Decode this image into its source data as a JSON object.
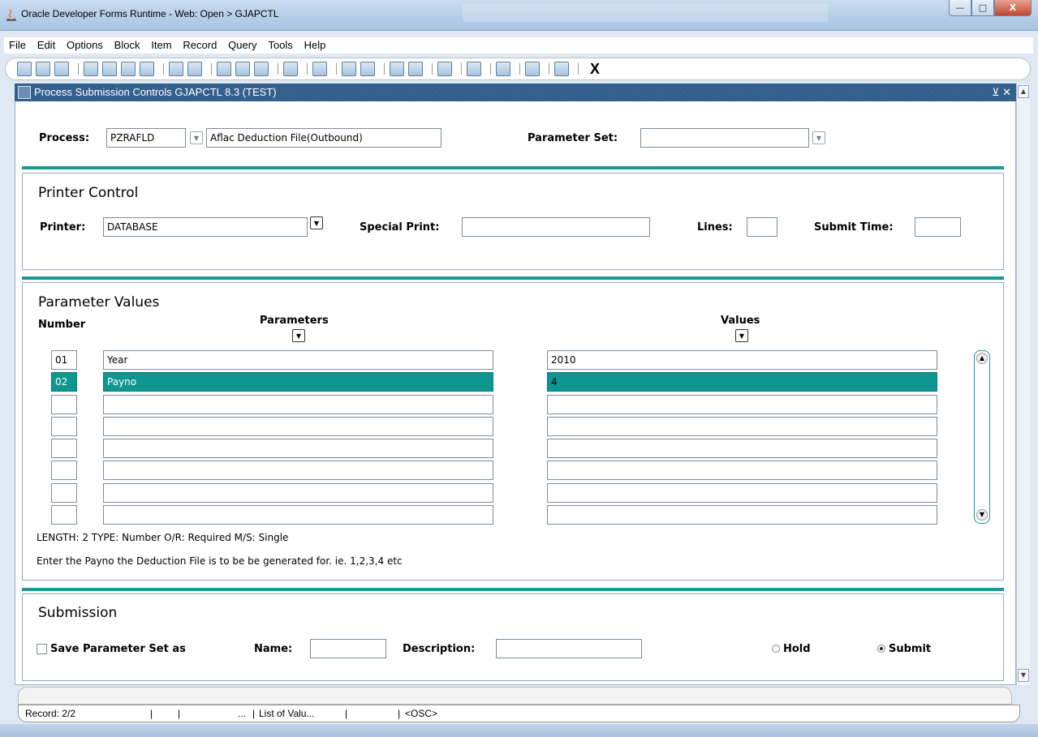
{
  "window": {
    "title": "Oracle Developer Forms Runtime - Web:  Open > GJAPCTL",
    "min_label": "—",
    "max_label": "□",
    "close_label": "X"
  },
  "menu": [
    "File",
    "Edit",
    "Options",
    "Block",
    "Item",
    "Record",
    "Query",
    "Tools",
    "Help"
  ],
  "menu_underline": [
    "F",
    "E",
    "O",
    "B",
    "I",
    "R",
    "Q",
    "T",
    "H"
  ],
  "toolbar": {
    "icons": [
      "save-icon",
      "rollback-icon",
      "print-icon",
      "insert-record-icon",
      "remove-record-icon",
      "first-record-icon",
      "last-record-icon",
      "enter-query-icon",
      "execute-query-icon",
      "count-query-icon",
      "cancel-query-icon",
      "duplicate-icon",
      "clear-icon",
      "search-icon",
      "new-icon",
      "expand-icon",
      "collapse-icon",
      "speaker-icon",
      "target-icon",
      "export-icon",
      "help-icon",
      "lightbulb-icon"
    ],
    "exit_label": "X"
  },
  "form": {
    "title": "Process Submission Controls  GJAPCTL  8.3  (TEST)",
    "title_controls": "⊻ ✕",
    "process_label": "Process:",
    "process_value": "PZRAFLD",
    "process_desc": "Aflac Deduction File(Outbound)",
    "parameter_set_label": "Parameter Set:",
    "parameter_set_value": ""
  },
  "printer_control": {
    "title": "Printer Control",
    "printer_label": "Printer:",
    "printer_value": "DATABASE",
    "special_print_label": "Special Print:",
    "special_print_value": "",
    "lines_label": "Lines:",
    "lines_value": "",
    "submit_time_label": "Submit Time:",
    "submit_time_value": ""
  },
  "parameter_values": {
    "title": "Parameter Values",
    "number_header": "Number",
    "parameters_header": "Parameters",
    "values_header": "Values",
    "rows": [
      {
        "number": "01",
        "parameter": "Year",
        "value": "2010"
      },
      {
        "number": "02",
        "parameter": "Payno",
        "value": "4"
      },
      {
        "number": "",
        "parameter": "",
        "value": ""
      },
      {
        "number": "",
        "parameter": "",
        "value": ""
      },
      {
        "number": "",
        "parameter": "",
        "value": ""
      },
      {
        "number": "",
        "parameter": "",
        "value": ""
      },
      {
        "number": "",
        "parameter": "",
        "value": ""
      },
      {
        "number": "",
        "parameter": "",
        "value": ""
      }
    ],
    "selected_row": 1,
    "hint_line1": "LENGTH: 2 TYPE: Number O/R: Required M/S: Single",
    "hint_line2": "Enter the Payno the Deduction File is to be be generated for.  ie. 1,2,3,4 etc"
  },
  "submission": {
    "title": "Submission",
    "save_param_label": "Save Parameter Set as",
    "name_label": "Name:",
    "name_value": "",
    "description_label": "Description:",
    "description_value": "",
    "hold_label": "Hold",
    "submit_label": "Submit",
    "selected": "Submit"
  },
  "status": {
    "record": "Record: 2/2",
    "seg_dots": "...",
    "list_of_values": "List of Valu...",
    "osc": "<OSC>"
  }
}
